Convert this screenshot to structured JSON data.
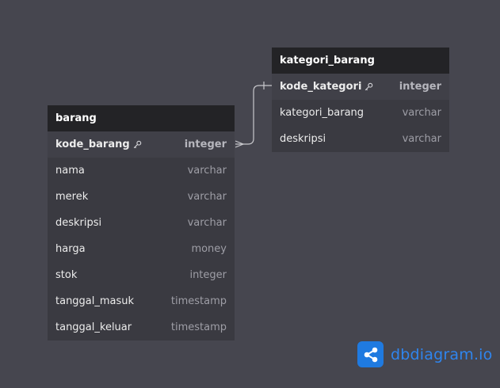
{
  "tables": {
    "barang": {
      "name": "barang",
      "columns": [
        {
          "name": "kode_barang",
          "type": "integer",
          "pk": true
        },
        {
          "name": "nama",
          "type": "varchar"
        },
        {
          "name": "merek",
          "type": "varchar"
        },
        {
          "name": "deskripsi",
          "type": "varchar"
        },
        {
          "name": "harga",
          "type": "money"
        },
        {
          "name": "stok",
          "type": "integer"
        },
        {
          "name": "tanggal_masuk",
          "type": "timestamp"
        },
        {
          "name": "tanggal_keluar",
          "type": "timestamp"
        }
      ]
    },
    "kategori_barang": {
      "name": "kategori_barang",
      "columns": [
        {
          "name": "kode_kategori",
          "type": "integer",
          "pk": true
        },
        {
          "name": "kategori_barang",
          "type": "varchar"
        },
        {
          "name": "deskripsi",
          "type": "varchar"
        }
      ]
    }
  },
  "relationship": {
    "from": "kategori_barang.kode_kategori",
    "to": "barang.kode_barang",
    "from_cardinality": "one",
    "to_cardinality": "many"
  },
  "brand": {
    "name": "dbdiagram",
    "tld": ".io",
    "color": "#2f85ee",
    "icon": "share-icon"
  },
  "colors": {
    "canvas": "#46464f",
    "header": "#232326",
    "table_body": "#3a3a41",
    "line": "#c8c8cc"
  }
}
